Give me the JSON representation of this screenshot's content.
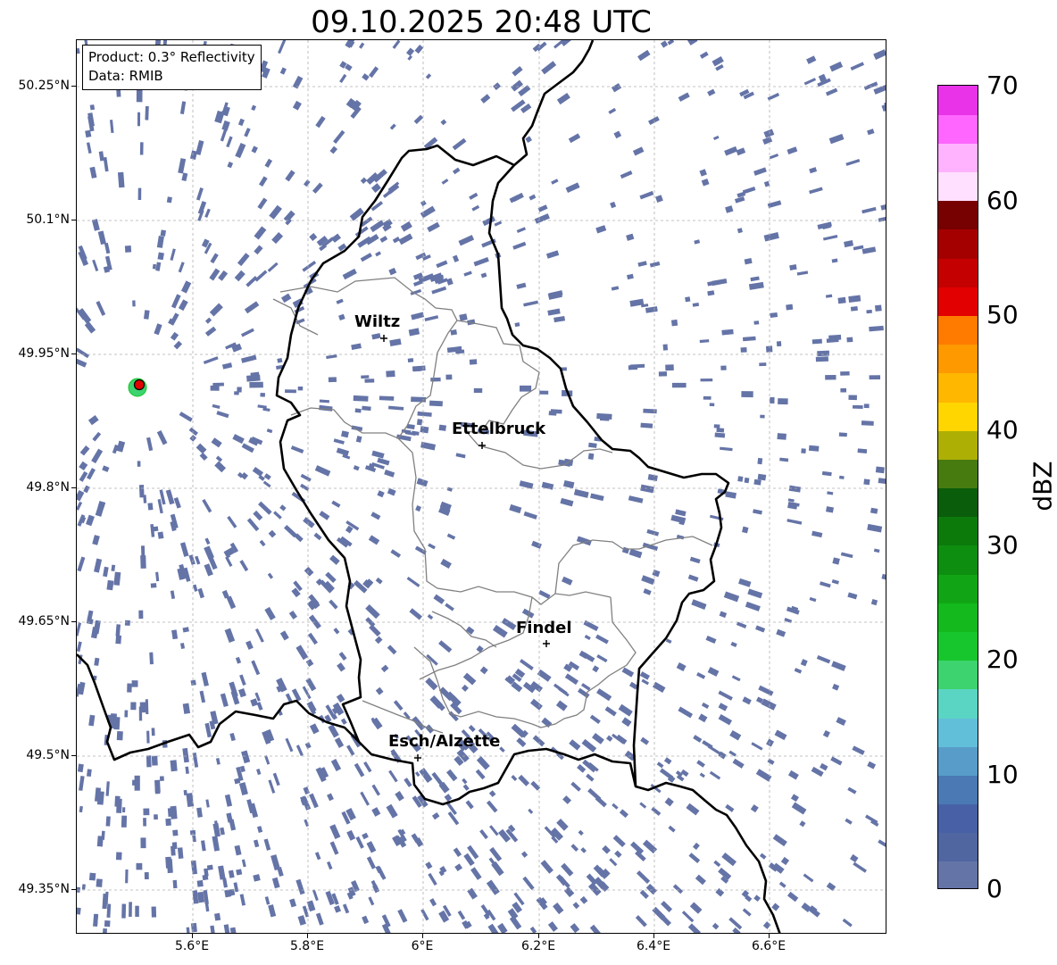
{
  "title": "09.10.2025 20:48 UTC",
  "info": {
    "product": "Product: 0.3° Reflectivity",
    "source": "Data: RMIB"
  },
  "axes": {
    "y_labels": [
      "50.25°N",
      "50.1°N",
      "49.95°N",
      "49.8°N",
      "49.65°N",
      "49.5°N",
      "49.35°N"
    ],
    "x_labels": [
      "5.6°E",
      "5.8°E",
      "6°E",
      "6.2°E",
      "6.4°E",
      "6.6°E"
    ]
  },
  "cities": {
    "wiltz": "Wiltz",
    "ettelbruck": "Ettelbruck",
    "findel": "Findel",
    "esch": "Esch/Alzette"
  },
  "colorbar": {
    "unit": "dBZ",
    "labels": [
      "70",
      "60",
      "50",
      "40",
      "30",
      "20",
      "10",
      "0"
    ],
    "colors": [
      "#6574a7",
      "#5066a0",
      "#4861a6",
      "#4b79b4",
      "#589dc9",
      "#62bfda",
      "#5ad5c3",
      "#3dd36e",
      "#17c62c",
      "#13b91d",
      "#11a515",
      "#0e8e10",
      "#0b7a0b",
      "#0a5d0a",
      "#477b10",
      "#adaf05",
      "#ffd600",
      "#ffb700",
      "#ff9900",
      "#ff7b00",
      "#e30000",
      "#c50000",
      "#a50000",
      "#770000",
      "#ffe0ff",
      "#ffb3ff",
      "#ff66ff",
      "#e833e8"
    ]
  },
  "colors": {
    "echo": "#6574a7",
    "border": "#000000",
    "canton": "#808080",
    "grid": "#b0b0b0"
  }
}
